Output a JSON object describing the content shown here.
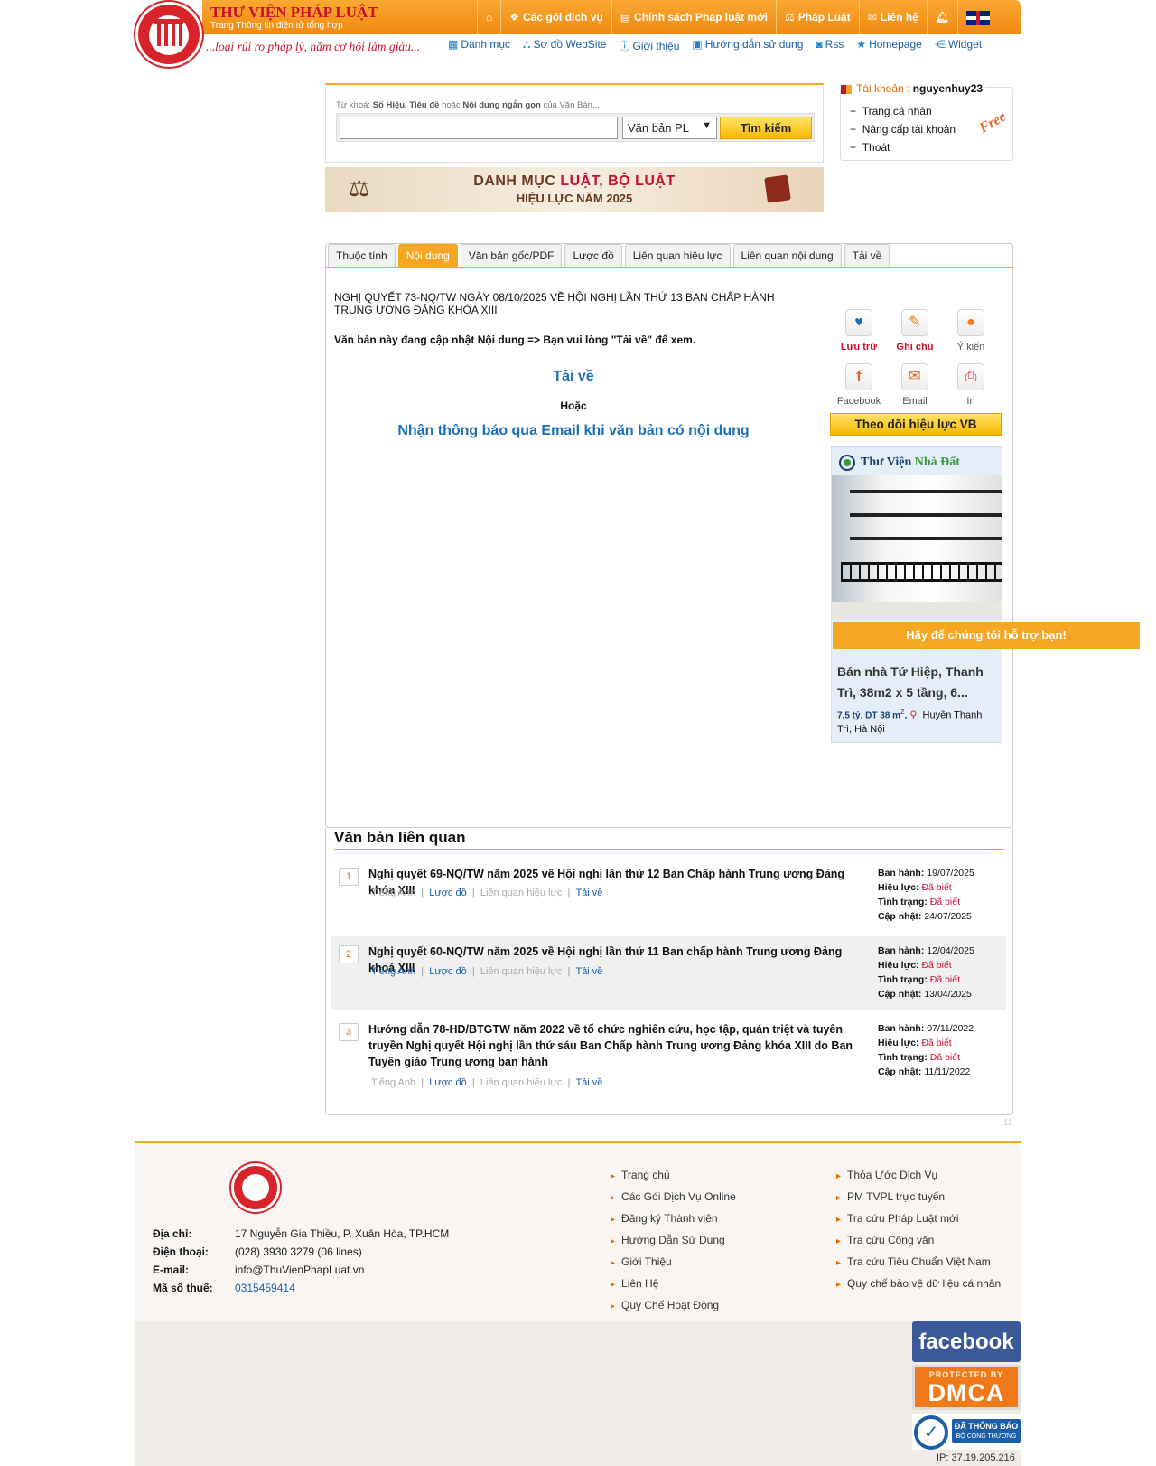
{
  "header": {
    "brand": "THƯ VIỆN PHÁP LUẬT",
    "brand_sub": "Trang Thông tin điện tử tổng hợp",
    "tagline": "...loại rủi ro pháp lý, nắm cơ hội làm giàu...",
    "nav": {
      "packages": "Các gói dịch vụ",
      "new_policy": "Chính sách Pháp luật mới",
      "law": "Pháp Luật",
      "contact": "Liên hệ"
    },
    "subnav": {
      "catalog": "Danh mục",
      "sitemap": "Sơ đồ WebSite",
      "about": "Giới thiệu",
      "guide": "Hướng dẫn sử dụng",
      "rss": "Rss",
      "homepage": "Homepage",
      "widget": "Widget"
    }
  },
  "search": {
    "hint_prefix": "Từ khoá:",
    "hint_bold": "Số Hiệu, Tiêu đề",
    "hint_mid": "hoặc",
    "hint_bold2": "Nội dung ngắn gọn",
    "hint_suffix": "của Văn Bản...",
    "value": "",
    "type_selected": "Văn bản PL",
    "button": "Tìm kiếm"
  },
  "account": {
    "label": "Tài khoản :",
    "username": "nguyenhuy23",
    "items": [
      "Trang cá nhân",
      "Nâng cấp tài khoản",
      "Thoát"
    ],
    "free": "Free"
  },
  "banner": {
    "line1_a": "DANH MỤC",
    "line1_b": "LUẬT",
    "line1_c": ",",
    "line1_d": "BỘ LUẬT",
    "line2": "HIỆU LỰC NĂM 2025"
  },
  "tabs": [
    "Thuộc tính",
    "Nội dung",
    "Văn bản gốc/PDF",
    "Lược đồ",
    "Liên quan hiệu lực",
    "Liên quan nội dung",
    "Tải về"
  ],
  "document": {
    "title": "NGHỊ QUYẾT 73-NQ/TW NGÀY 08/10/2025 VỀ HỘI NGHỊ LẦN THỨ 13 BAN CHẤP HÀNH TRUNG ƯƠNG ĐẢNG KHÓA XIII",
    "note": "Văn bản này đang cập nhật Nội dung => Bạn vui lòng \"Tải về\" để xem.",
    "download": "Tải về",
    "or": "Hoặc",
    "email_notify": "Nhận thông báo qua Email khi văn bản có nội dung"
  },
  "tools": {
    "save": "Lưu trữ",
    "note": "Ghi chú",
    "opinion": "Ý kiến",
    "facebook": "Facebook",
    "email": "Email",
    "print": "In",
    "follow": "Theo dõi hiệu lực VB"
  },
  "ad": {
    "brand_a": "Thư Viện",
    "brand_b": "Nhà Đất",
    "title": "Bán nhà Tứ Hiệp, Thanh Trì, 38m2 x 5 tầng, 6...",
    "price": "7.5 tỷ, DT 38 m",
    "sup": "2",
    "location": "Huyện Thanh Trì, Hà Nội"
  },
  "support": "Hãy để chúng tôi hỗ trợ bạn!",
  "related": {
    "title": "Văn bản liên quan",
    "labels": {
      "issued": "Ban hành:",
      "effect": "Hiệu lực:",
      "status": "Tình trạng:",
      "updated": "Cập nhật:"
    },
    "links": {
      "en": "Tiếng Anh",
      "diagram": "Lược đồ",
      "rel": "Liên quan hiệu lực",
      "dl": "Tải về"
    },
    "items": [
      {
        "num": "1",
        "name": "Nghị quyết 69-NQ/TW năm 2025 về Hội nghị lần thứ 12 Ban Chấp hành Trung ương Đảng khóa XIII",
        "issued": "19/07/2025",
        "effect": "Đã biết",
        "status": "Đã biết",
        "updated": "24/07/2025"
      },
      {
        "num": "2",
        "name": "Nghị quyết 60-NQ/TW năm 2025 về Hội nghị lần thứ 11 Ban chấp hành Trung ương Đảng khoá XIII",
        "issued": "12/04/2025",
        "effect": "Đã biết",
        "status": "Đã biết",
        "updated": "13/04/2025"
      },
      {
        "num": "3",
        "name": "Hướng dẫn 78-HD/BTGTW năm 2022 về tổ chức nghiên cứu, học tập, quán triệt và tuyên truyền Nghị quyết Hội nghị lần thứ sáu Ban Chấp hành Trung ương Đảng khóa XIII do Ban Tuyên giáo Trung ương ban hành",
        "issued": "07/11/2022",
        "effect": "Đã biết",
        "status": "Đã biết",
        "updated": "11/11/2022"
      }
    ]
  },
  "page_number": "11",
  "footer": {
    "address_label": "Địa chỉ:",
    "address": "17 Nguyễn Gia Thiều, P. Xuân Hòa, TP.HCM",
    "phone_label": "Điện thoại:",
    "phone": "(028) 3930 3279 (06 lines)",
    "email_label": "E-mail:",
    "email": "info@ThuVienPhapLuat.vn",
    "tax_label": "Mã số thuế:",
    "tax": "0315459414",
    "col1": [
      "Trang chủ",
      "Các Gói Dịch Vụ Online",
      "Đăng ký Thành viên",
      "Hướng Dẫn Sử Dụng",
      "Giới Thiệu",
      "Liên Hệ",
      "Quy Chế Hoạt Động"
    ],
    "col2": [
      "Thỏa Ước Dịch Vụ",
      "PM TVPL trực tuyến",
      "Tra cứu Pháp Luật mới",
      "Tra cứu Công văn",
      "Tra cứu Tiêu Chuẩn Việt Nam",
      "Quy chế bảo vệ dữ liệu cá nhân"
    ]
  },
  "badges": {
    "facebook": "facebook",
    "dmca_small": "PROTECTED BY",
    "dmca": "DMCA",
    "bct_line1": "ĐÃ THÔNG BÁO",
    "bct_line2": "BỘ CÔNG THƯƠNG"
  },
  "ip": "IP: 37.19.205.216"
}
